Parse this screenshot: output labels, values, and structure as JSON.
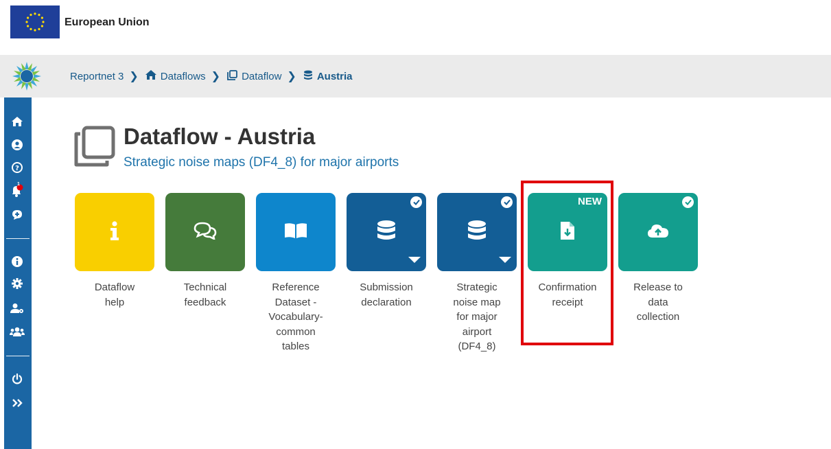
{
  "eu_header": {
    "label": "European Union"
  },
  "breadcrumb": [
    {
      "label": "Reportnet 3",
      "icon": "none"
    },
    {
      "label": "Dataflows",
      "icon": "home-icon"
    },
    {
      "label": "Dataflow",
      "icon": "clone-icon"
    },
    {
      "label": "Austria",
      "icon": "database-icon"
    }
  ],
  "sidebar": {
    "items": [
      "home-icon",
      "user-icon",
      "help-icon",
      "notifications-icon",
      "feedback-icon",
      "info-icon",
      "settings-icon",
      "user-settings-icon",
      "users-icon",
      "logout-icon",
      "expand-icon"
    ],
    "notification_count": "1"
  },
  "page": {
    "title": "Dataflow - Austria",
    "subtitle": "Strategic noise maps (DF4_8) for major airports"
  },
  "cards": [
    {
      "label": "Dataflow\nhelp",
      "icon": "info-icon",
      "color": "#f9cf00"
    },
    {
      "label": "Technical\nfeedback",
      "icon": "comments-icon",
      "color": "#457b3b"
    },
    {
      "label": "Reference\nDataset -\nVocabulary-\ncommon\ntables",
      "icon": "book-icon",
      "color": "#0e86cc"
    },
    {
      "label": "Submission\ndeclaration",
      "icon": "database-icon",
      "color": "#135e96"
    },
    {
      "label": "Strategic\nnoise map\nfor major\nairport\n(DF4_8)",
      "icon": "database-icon",
      "color": "#135e96"
    },
    {
      "label": "Confirmation\nreceipt",
      "icon": "file-download-icon",
      "color": "#139e8e",
      "badge": "NEW"
    },
    {
      "label": "Release to\ndata\ncollection",
      "icon": "cloud-upload-icon",
      "color": "#139e8e"
    }
  ],
  "colors": {
    "accent_blue": "#1f74ab",
    "sidebar": "#1b66a4",
    "highlight": "#e0000b"
  }
}
